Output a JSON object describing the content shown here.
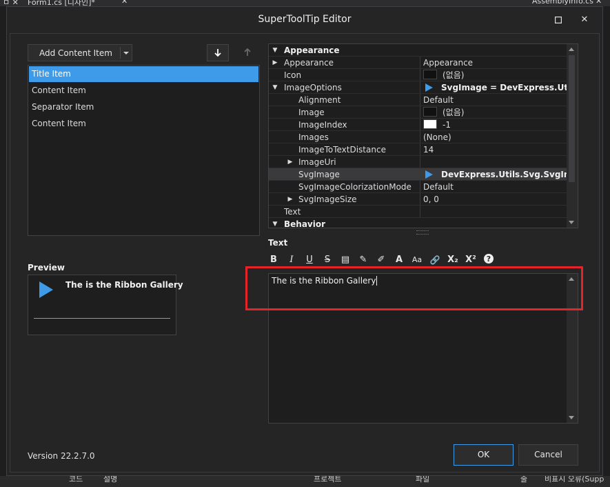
{
  "ide": {
    "tab1": "Form1.cs [디자인]*",
    "tab2": "AssemblyInfo.cs",
    "bottom_cols": [
      "코드",
      "설명",
      "프로젝트",
      "파일",
      "줄",
      "비표시 오류(Supp"
    ]
  },
  "dialog": {
    "title": "SuperToolTip Editor",
    "add_button": "Add Content Item",
    "list_items": [
      "Title Item",
      "Content Item",
      "Separator Item",
      "Content Item"
    ],
    "preview_label": "Preview",
    "preview_title": "The is the Ribbon Gallery",
    "text_label": "Text",
    "editor_text": "The is the Ribbon Gallery",
    "version": "Version 22.2.7.0",
    "ok": "OK",
    "cancel": "Cancel"
  },
  "props": [
    {
      "name": "Appearance",
      "value": "",
      "level": 0,
      "category": true,
      "expand": "open"
    },
    {
      "name": "Appearance",
      "value": "Appearance",
      "level": 1,
      "expand": "closed"
    },
    {
      "name": "Icon",
      "value": "(없음)",
      "level": 1,
      "swatch": "#111111"
    },
    {
      "name": "ImageOptions",
      "value": "SvgImage = DevExpress.Utils.Svg.SvgImage",
      "level": 1,
      "expand": "open",
      "play": true,
      "bold": true
    },
    {
      "name": "Alignment",
      "value": "Default",
      "level": 2
    },
    {
      "name": "Image",
      "value": "(없음)",
      "level": 2,
      "swatch": "#111111"
    },
    {
      "name": "ImageIndex",
      "value": "-1",
      "level": 2,
      "swatch": "#ffffff"
    },
    {
      "name": "Images",
      "value": "(None)",
      "level": 2
    },
    {
      "name": "ImageToTextDistance",
      "value": "14",
      "level": 2
    },
    {
      "name": "ImageUri",
      "value": "",
      "level": 2,
      "expand": "closed"
    },
    {
      "name": "SvgImage",
      "value": "DevExpress.Utils.Svg.SvgImage",
      "level": 2,
      "play": true,
      "bold": true,
      "highlight": true
    },
    {
      "name": "SvgImageColorizationMode",
      "value": "Default",
      "level": 2
    },
    {
      "name": "SvgImageSize",
      "value": "0, 0",
      "level": 2,
      "expand": "closed"
    },
    {
      "name": "Text",
      "value": "",
      "level": 1
    },
    {
      "name": "Behavior",
      "value": "",
      "level": 0,
      "category": true,
      "expand": "open"
    }
  ],
  "toolbar": [
    "B",
    "I",
    "U",
    "S",
    "▤",
    "✎",
    "✐",
    "A",
    "Aa",
    "🔗",
    "X₂",
    "X²",
    "?"
  ],
  "colors": {
    "accent": "#3d9be9",
    "highlight_border": "#e3242b"
  }
}
